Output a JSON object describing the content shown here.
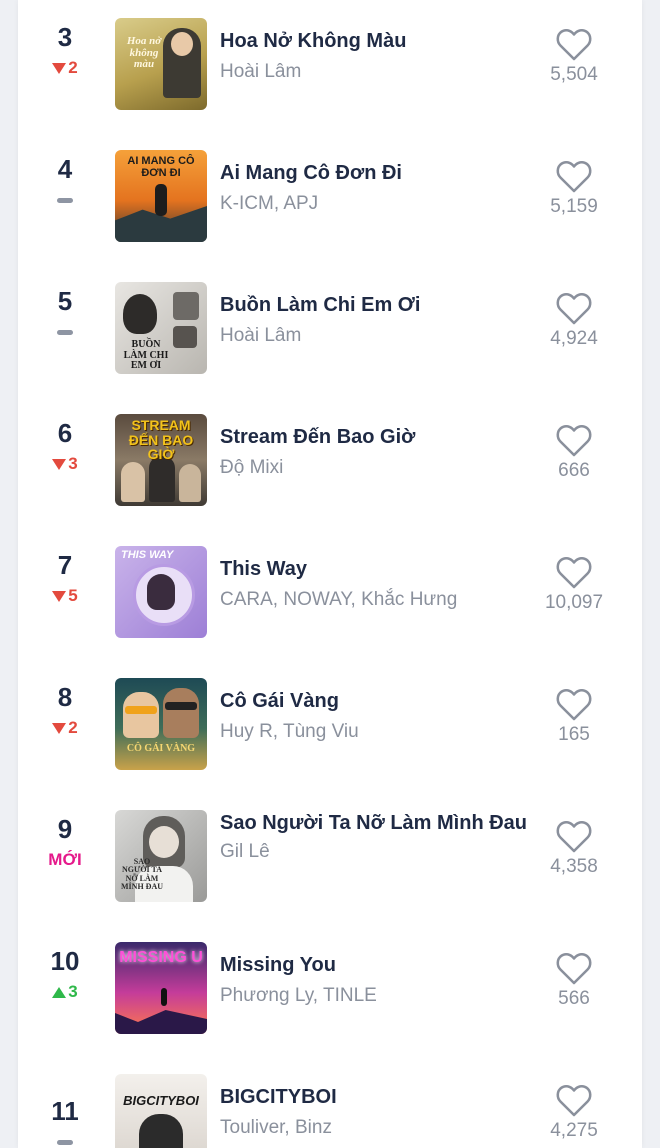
{
  "songs": [
    {
      "rank": "3",
      "change": "2",
      "trend": "down",
      "title": "Hoa Nở Không Màu",
      "artist": "Hoài Lâm",
      "likes": "5,504",
      "cover_text": "Hoa nở không màu"
    },
    {
      "rank": "4",
      "change": "",
      "trend": "same",
      "title": "Ai Mang Cô Đơn Đi",
      "artist": "K-ICM, APJ",
      "likes": "5,159",
      "cover_text": "AI MANG CÔ ĐƠN ĐI"
    },
    {
      "rank": "5",
      "change": "",
      "trend": "same",
      "title": "Buồn Làm Chi Em Ơi",
      "artist": "Hoài Lâm",
      "likes": "4,924",
      "cover_text": "BUỒN LÀM CHI EM ƠI"
    },
    {
      "rank": "6",
      "change": "3",
      "trend": "down",
      "title": "Stream Đến Bao Giờ",
      "artist": "Độ Mixi",
      "likes": "666",
      "cover_text": "STREAM ĐẾN BAO GIỜ"
    },
    {
      "rank": "7",
      "change": "5",
      "trend": "down",
      "title": "This Way",
      "artist": "CARA, NOWAY, Khắc Hưng",
      "likes": "10,097",
      "cover_text": "THIS WAY"
    },
    {
      "rank": "8",
      "change": "2",
      "trend": "down",
      "title": "Cô Gái Vàng",
      "artist": "Huy R, Tùng Viu",
      "likes": "165",
      "cover_text": "CÔ GÁI VÀNG"
    },
    {
      "rank": "9",
      "change": "MỚI",
      "trend": "new",
      "title": "Sao Người Ta Nỡ Làm Mình Đau",
      "artist": "Gil Lê",
      "likes": "4,358",
      "cover_text": "SAO NGƯỜI TA NỠ LÀM MÌNH ĐAU"
    },
    {
      "rank": "10",
      "change": "3",
      "trend": "up",
      "title": "Missing You",
      "artist": "Phương Ly, TINLE",
      "likes": "566",
      "cover_text": "MISSING U"
    },
    {
      "rank": "11",
      "change": "",
      "trend": "same",
      "title": "BIGCITYBOI",
      "artist": "Touliver, Binz",
      "likes": "4,275",
      "cover_text": "BIGCITYBOI"
    }
  ],
  "colors": {
    "title": "#1f2a44",
    "muted": "#8a909c",
    "down": "#e34a3e",
    "up": "#2fb84a",
    "new": "#e5198b"
  },
  "icons": {
    "like": "heart-outline-icon",
    "same": "dash-icon",
    "down": "triangle-down-icon",
    "up": "triangle-up-icon"
  }
}
